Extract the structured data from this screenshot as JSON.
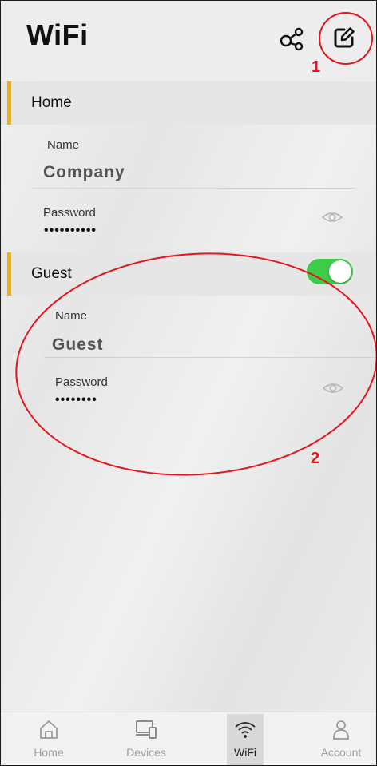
{
  "header": {
    "title": "WiFi"
  },
  "sections": [
    {
      "label": "Home",
      "name_label": "Name",
      "name_value": "Company",
      "password_label": "Password",
      "password_value": "••••••••••"
    },
    {
      "label": "Guest",
      "name_label": "Name",
      "name_value": "Guest",
      "password_label": "Password",
      "password_value": "••••••••",
      "enabled": true
    }
  ],
  "callouts": [
    "1",
    "2"
  ],
  "nav": [
    {
      "label": "Home",
      "icon": "home-icon"
    },
    {
      "label": "Devices",
      "icon": "devices-icon"
    },
    {
      "label": "WiFi",
      "icon": "wifi-icon",
      "active": true
    },
    {
      "label": "Account",
      "icon": "account-icon"
    }
  ],
  "colors": {
    "accent_bar": "#f1b000",
    "toggle_on": "#3dcb4a",
    "callout": "#e8141c"
  }
}
